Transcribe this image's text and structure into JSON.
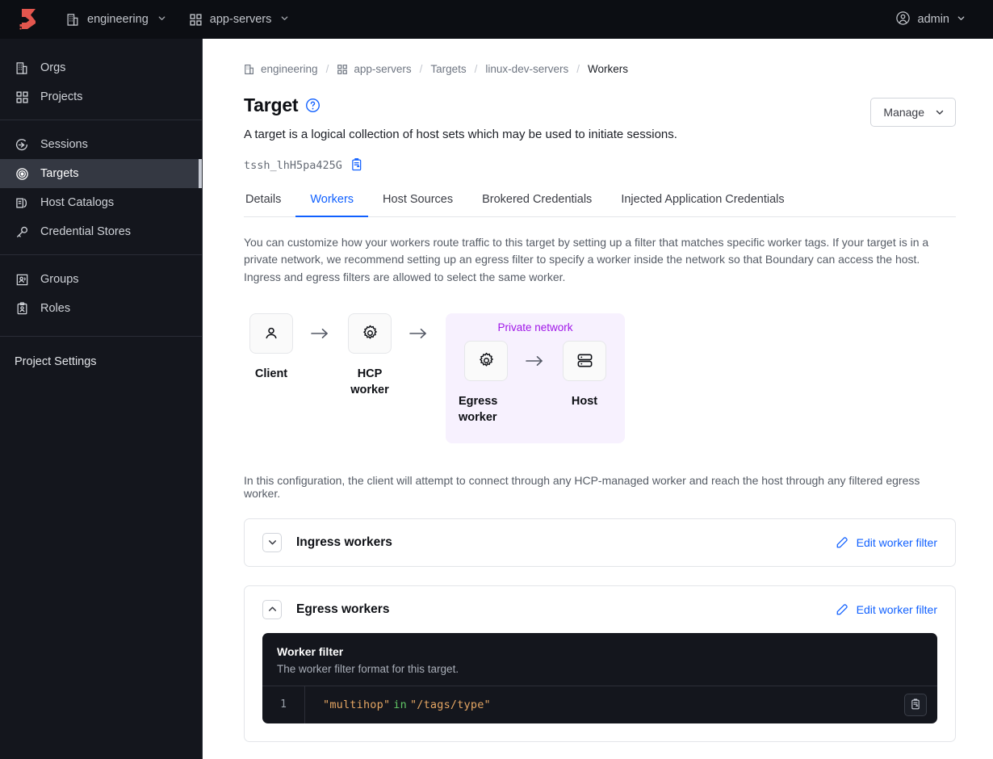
{
  "topbar": {
    "logo": "boundary-logo",
    "org": {
      "label": "engineering",
      "icon": "org-building-icon"
    },
    "project": {
      "label": "app-servers",
      "icon": "grid-squares-icon"
    },
    "user": {
      "label": "admin",
      "icon": "user-circle-icon"
    }
  },
  "sidebar": {
    "groups": [
      {
        "items": [
          {
            "label": "Orgs",
            "icon": "org-building-icon",
            "active": false
          },
          {
            "label": "Projects",
            "icon": "grid-squares-icon",
            "active": false
          }
        ]
      },
      {
        "items": [
          {
            "label": "Sessions",
            "icon": "session-arrow-icon",
            "active": false
          },
          {
            "label": "Targets",
            "icon": "target-bullseye-icon",
            "active": true
          },
          {
            "label": "Host Catalogs",
            "icon": "host-catalog-icon",
            "active": false
          },
          {
            "label": "Credential Stores",
            "icon": "key-icon",
            "active": false
          }
        ]
      },
      {
        "items": [
          {
            "label": "Groups",
            "icon": "groups-icon",
            "active": false
          },
          {
            "label": "Roles",
            "icon": "roles-icon",
            "active": false
          }
        ]
      }
    ],
    "settings_label": "Project Settings"
  },
  "breadcrumb": {
    "items": [
      {
        "label": "engineering",
        "icon": "org-building-icon",
        "current": false
      },
      {
        "label": "app-servers",
        "icon": "grid-squares-icon",
        "current": false
      },
      {
        "label": "Targets",
        "icon": null,
        "current": false
      },
      {
        "label": "linux-dev-servers",
        "icon": null,
        "current": false
      },
      {
        "label": "Workers",
        "icon": null,
        "current": true
      }
    ],
    "separator": "/"
  },
  "page": {
    "title": "Target",
    "help_icon": "question-circle-icon",
    "description": "A target is a logical collection of host sets which may be used to initiate sessions.",
    "resource_id": "tssh_lhH5pa425G",
    "copy_icon": "copy-clipboard-icon",
    "manage_label": "Manage",
    "manage_chevron": "chevron-down-icon"
  },
  "tabs": [
    {
      "label": "Details",
      "active": false
    },
    {
      "label": "Workers",
      "active": true
    },
    {
      "label": "Host Sources",
      "active": false
    },
    {
      "label": "Brokered Credentials",
      "active": false
    },
    {
      "label": "Injected Application Credentials",
      "active": false
    }
  ],
  "intro_text": "You can customize how your workers route traffic to this target by setting up a filter that matches specific worker tags. If your target is in a private network, we recommend setting up an egress filter to specify a worker inside the network so that Boundary can access the host. Ingress and egress filters are allowed to select the same worker.",
  "diagram": {
    "client": {
      "label": "Client",
      "icon": "user-icon"
    },
    "hcp_worker": {
      "label": "HCP\nworker",
      "label_line1": "HCP",
      "label_line2": "worker",
      "icon": "gear-icon"
    },
    "private_network_label": "Private network",
    "egress_worker": {
      "label_line1": "Egress",
      "label_line2": "worker",
      "icon": "gear-icon"
    },
    "host": {
      "label": "Host",
      "icon": "server-icon"
    },
    "arrow_icon": "arrow-right-icon"
  },
  "config_note": "In this configuration, the client will attempt to connect through any HCP-managed worker and reach the host through any filtered egress worker.",
  "accordions": [
    {
      "title": "Ingress workers",
      "expanded": false,
      "toggle_icon": "chevron-down-icon",
      "action_label": "Edit worker filter",
      "action_icon": "edit-pencil-icon"
    },
    {
      "title": "Egress workers",
      "expanded": true,
      "toggle_icon": "chevron-up-icon",
      "action_label": "Edit worker filter",
      "action_icon": "edit-pencil-icon"
    }
  ],
  "worker_filter": {
    "title": "Worker filter",
    "subtitle": "The worker filter format for this target.",
    "line_number": "1",
    "code_tokens": [
      {
        "text": "\"multihop\"",
        "type": "string"
      },
      {
        "text": "in",
        "type": "operator"
      },
      {
        "text": "\"/tags/type\"",
        "type": "string"
      }
    ],
    "copy_icon": "copy-clipboard-icon"
  },
  "colors": {
    "accent_blue": "#1060ff",
    "brand_red": "#e3564e",
    "purple": "#a016e8",
    "private_net_bg": "#f7f1fe",
    "dark_panel": "#14161d",
    "code_string": "#e5a663",
    "code_operator": "#61c766"
  }
}
